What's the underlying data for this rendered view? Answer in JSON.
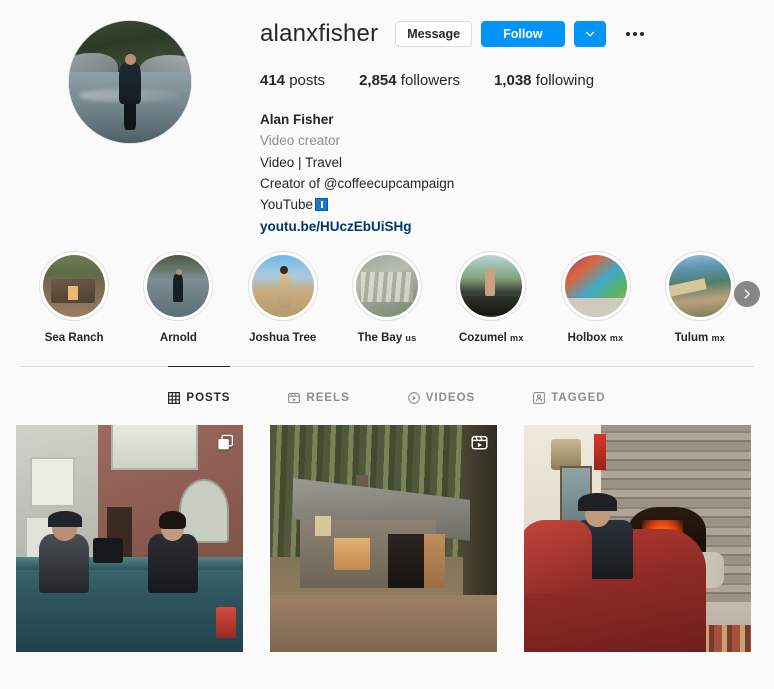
{
  "profile": {
    "username": "alanxfisher",
    "full_name": "Alan Fisher",
    "category": "Video creator",
    "bio_line_1": "Video | Travel",
    "bio_line_2": "Creator of @coffeecupcampaign",
    "bio_line_3": "YouTube",
    "link": "youtu.be/HUczEbUiSHg"
  },
  "actions": {
    "message_label": "Message",
    "follow_label": "Follow",
    "dropdown_icon": "chevron-down-icon",
    "more_icon": "ellipsis-icon"
  },
  "stats": [
    {
      "value": "414",
      "label": "posts"
    },
    {
      "value": "2,854",
      "label": "followers"
    },
    {
      "value": "1,038",
      "label": "following"
    }
  ],
  "highlights": {
    "next_icon": "chevron-right-icon",
    "items": [
      {
        "label": "Sea Ranch",
        "country": "",
        "art": "a-cabin"
      },
      {
        "label": "Arnold",
        "country": "",
        "art": "a-river"
      },
      {
        "label": "Joshua Tree",
        "country": "",
        "art": "a-desert"
      },
      {
        "label": "The Bay ",
        "country": "us",
        "art": "a-bay"
      },
      {
        "label": "Cozumel ",
        "country": "mx",
        "art": "a-jeep"
      },
      {
        "label": "Holbox ",
        "country": "mx",
        "art": "a-mural"
      },
      {
        "label": "Tulum ",
        "country": "mx",
        "art": "a-beach"
      }
    ]
  },
  "tabs": [
    {
      "label": "POSTS",
      "icon": "grid-icon",
      "active": true
    },
    {
      "label": "REELS",
      "icon": "reels-icon",
      "active": false
    },
    {
      "label": "VIDEOS",
      "icon": "play-circle-icon",
      "active": false
    },
    {
      "label": "TAGGED",
      "icon": "tag-person-icon",
      "active": false
    }
  ],
  "posts": [
    {
      "alt": "Two people filming in the bed of a teal pickup truck on a city street",
      "badge": "carousel-icon",
      "art": "p1"
    },
    {
      "alt": "Wooden cabin lit from within, surrounded by tall forest trees",
      "badge": "reels-icon",
      "art": "p2"
    },
    {
      "alt": "Man in a red leather armchair beside a stone fireplace",
      "badge": "",
      "art": "p3"
    }
  ],
  "colors": {
    "accent": "#0095f6",
    "link": "#00376b",
    "muted": "#8e8e8e",
    "text": "#262626",
    "background": "#fafafa"
  }
}
